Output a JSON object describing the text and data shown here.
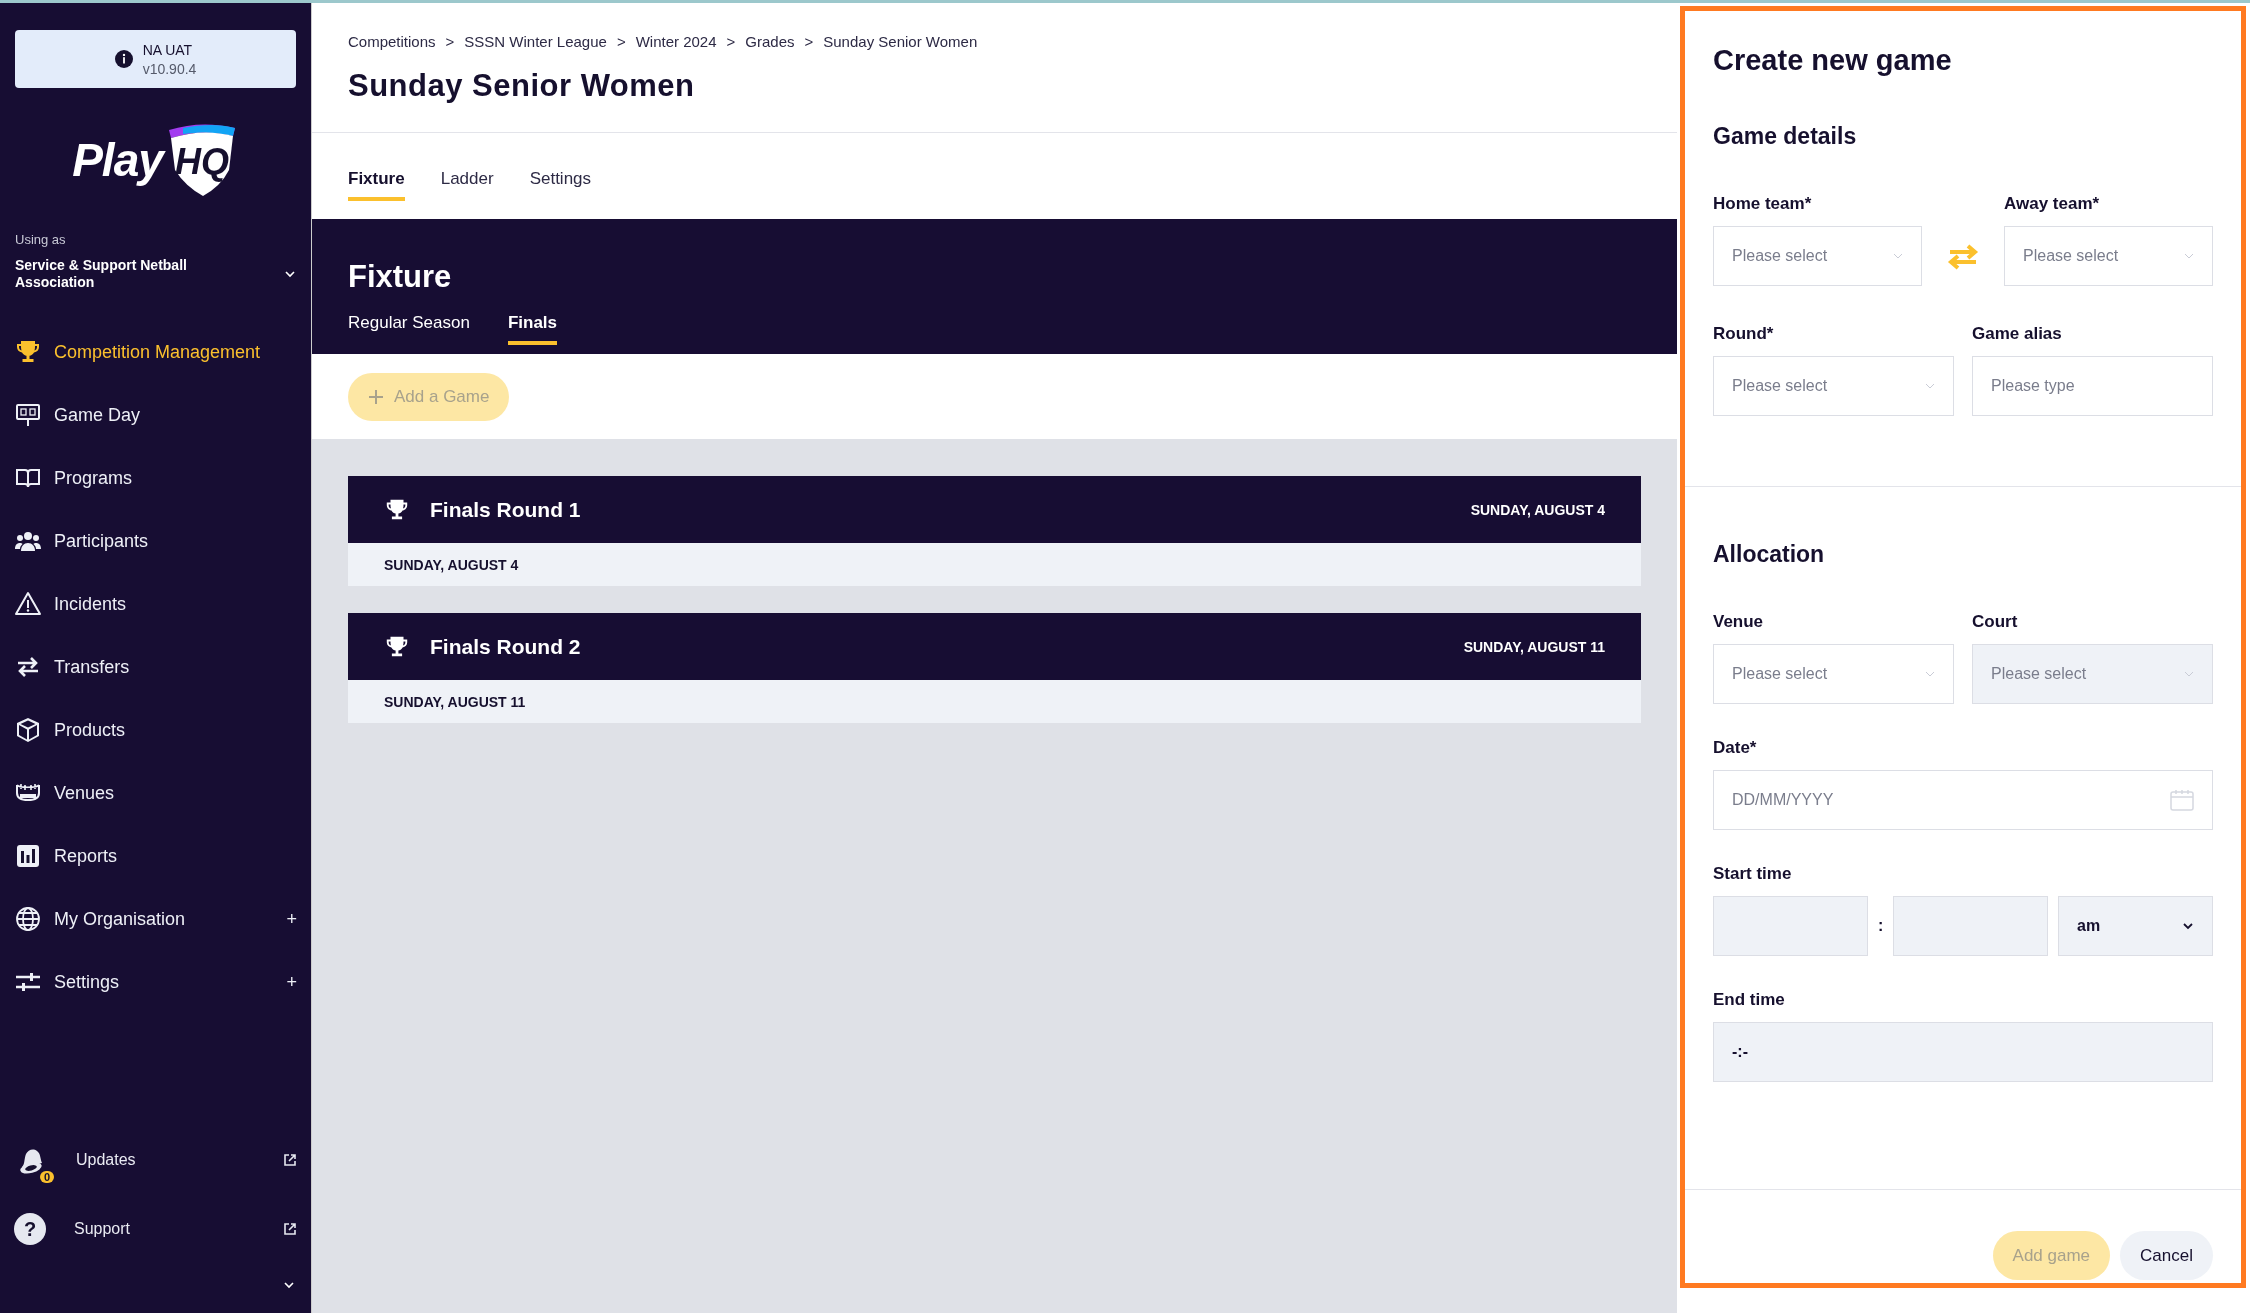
{
  "environment": {
    "name": "NA UAT",
    "version": "v10.90.4"
  },
  "logo": {
    "text": "Play",
    "badge": "HQ"
  },
  "organisation": {
    "caption": "Using as",
    "name": "Service & Support Netball Association"
  },
  "nav": [
    {
      "label": "Competition Management",
      "selected": true
    },
    {
      "label": "Game Day",
      "selected": false
    },
    {
      "label": "Programs",
      "selected": false
    },
    {
      "label": "Participants",
      "selected": false
    },
    {
      "label": "Incidents",
      "selected": false
    },
    {
      "label": "Transfers",
      "selected": false
    },
    {
      "label": "Products",
      "selected": false
    },
    {
      "label": "Venues",
      "selected": false
    },
    {
      "label": "Reports",
      "selected": false
    },
    {
      "label": "My Organisation",
      "selected": false,
      "toggle": "+"
    },
    {
      "label": "Settings",
      "selected": false,
      "toggle": "+"
    }
  ],
  "footer_links": [
    {
      "label": "Updates",
      "badge": "0"
    },
    {
      "label": "Support",
      "glyph": "?"
    }
  ],
  "breadcrumbs": [
    "Competitions",
    "SSSN Winter League",
    "Winter 2024",
    "Grades",
    "Sunday Senior Women"
  ],
  "breadcrumb_separator": ">",
  "page_title": "Sunday Senior Women",
  "tabs": [
    {
      "label": "Fixture",
      "selected": true
    },
    {
      "label": "Ladder",
      "selected": false
    },
    {
      "label": "Settings",
      "selected": false
    }
  ],
  "fixture": {
    "title": "Fixture",
    "tabs": [
      {
        "label": "Regular Season",
        "selected": false
      },
      {
        "label": "Finals",
        "selected": true
      }
    ],
    "add_button": {
      "label": "Add a Game",
      "disabled": true
    },
    "rounds": [
      {
        "title": "Finals Round 1",
        "date": "SUNDAY, AUGUST 4",
        "day": "SUNDAY, AUGUST 4"
      },
      {
        "title": "Finals Round 2",
        "date": "SUNDAY, AUGUST 11",
        "day": "SUNDAY, AUGUST 11"
      }
    ]
  },
  "form": {
    "title": "Create new game",
    "game_details": {
      "heading": "Game details",
      "home_team": {
        "label": "Home team*",
        "placeholder": "Please select"
      },
      "away_team": {
        "label": "Away team*",
        "placeholder": "Please select"
      },
      "round": {
        "label": "Round*",
        "placeholder": "Please select"
      },
      "game_alias": {
        "label": "Game alias",
        "placeholder": "Please type"
      }
    },
    "allocation": {
      "heading": "Allocation",
      "venue": {
        "label": "Venue",
        "placeholder": "Please select",
        "disabled": false
      },
      "court": {
        "label": "Court",
        "placeholder": "Please select",
        "disabled": true
      },
      "date": {
        "label": "Date*",
        "placeholder": "DD/MM/YYYY"
      },
      "start_time": {
        "label": "Start time",
        "separator": ":",
        "period": "am"
      },
      "end_time": {
        "label": "End time",
        "value": "-:-"
      }
    },
    "actions": [
      {
        "label": "Add game",
        "kind": "primary",
        "disabled": true
      },
      {
        "label": "Cancel",
        "kind": "secondary",
        "disabled": false
      }
    ]
  }
}
